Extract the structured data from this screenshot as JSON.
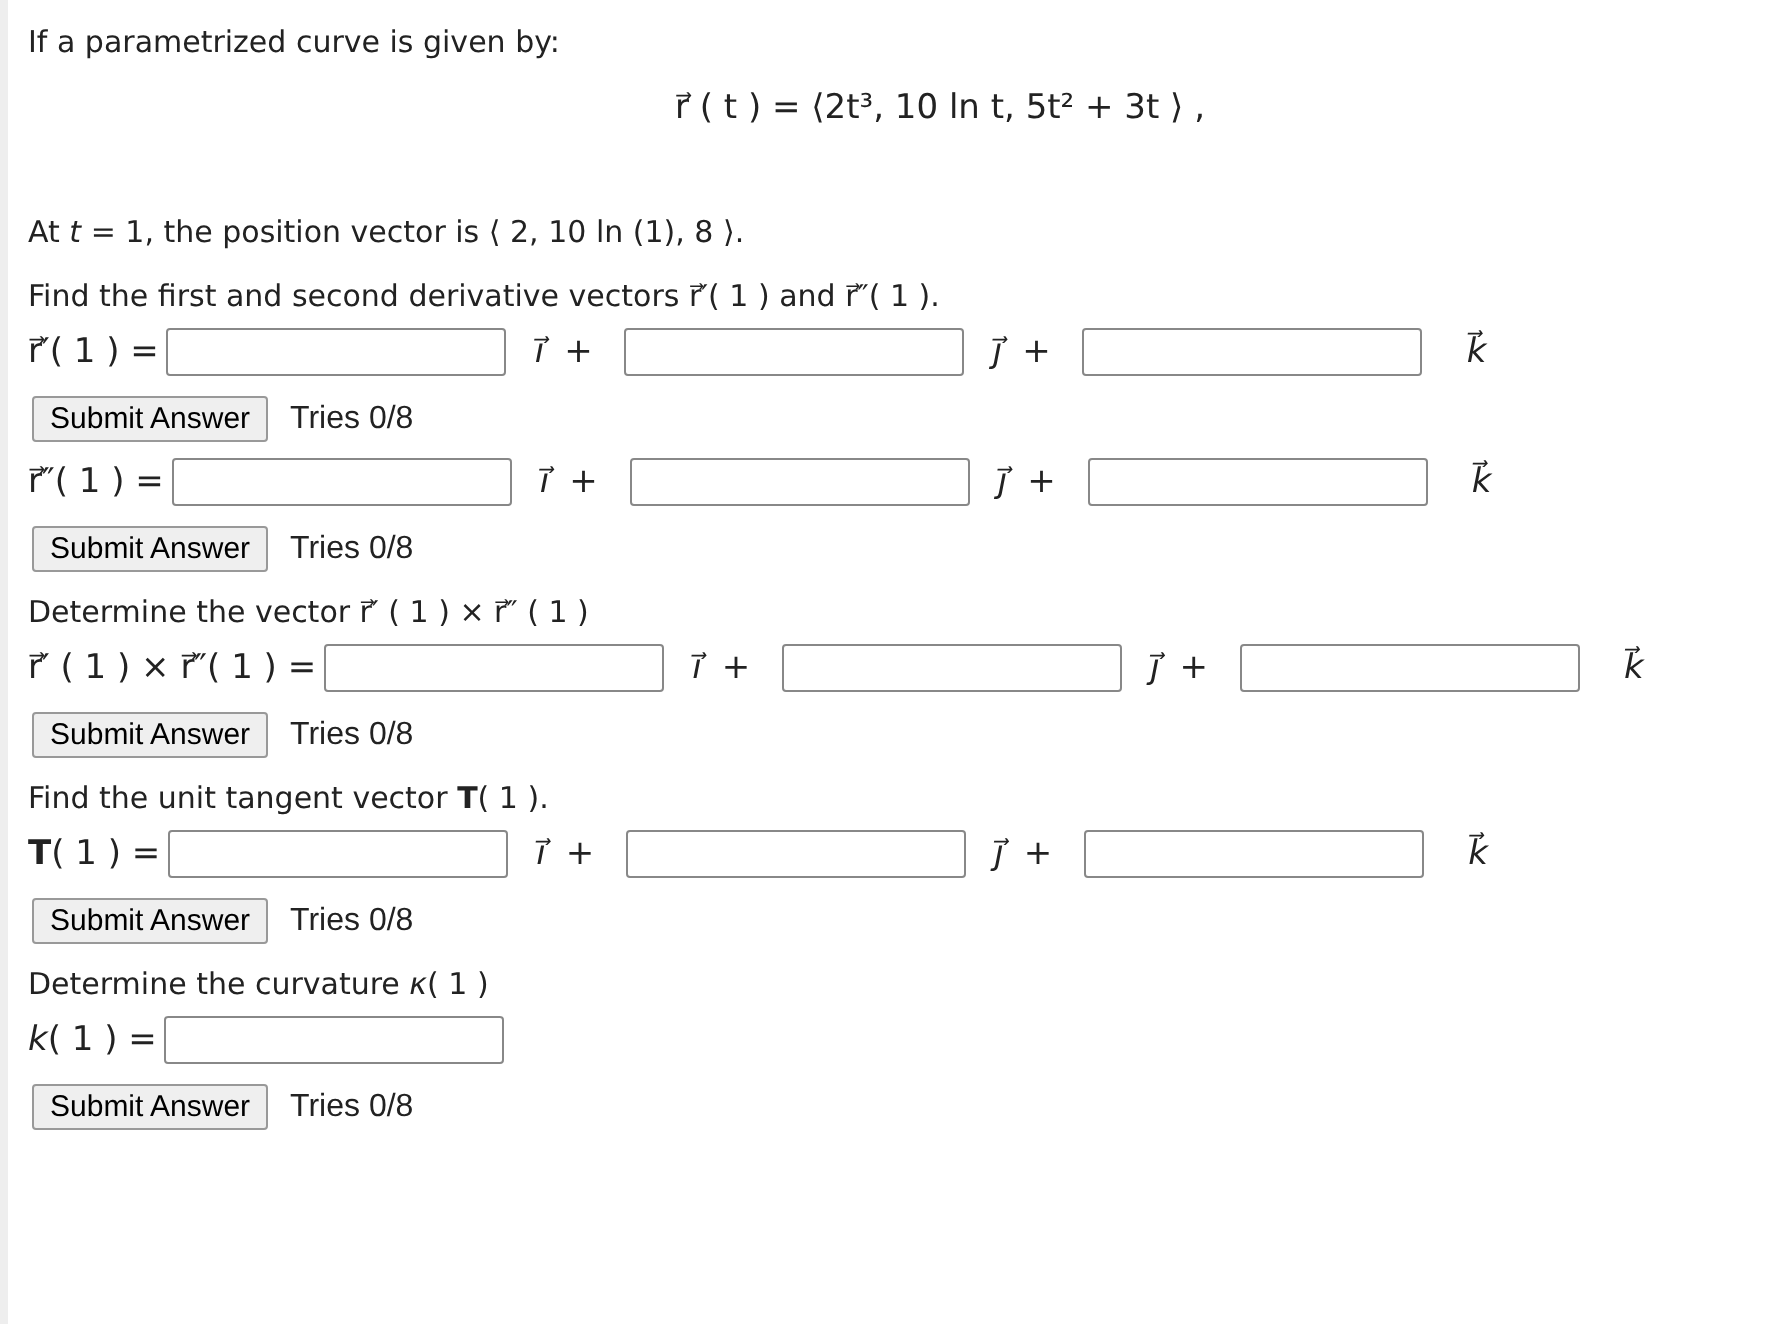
{
  "intro": "If a parametrized curve is given by:",
  "formula": "r⃗ ( t ) = ⟨2t³,  10 ln t,  5t² + 3t ⟩ ,",
  "items": [
    {
      "kind": "prompt",
      "text": "At *t* = 1, the position vector is ⟨ 2,  10 ln (1),  8 ⟩."
    },
    {
      "kind": "prompt",
      "text": "Find the first and second derivative vectors r⃗′( 1 ) and r⃗″( 1 )."
    },
    {
      "kind": "answer",
      "label": "r⃗′( 1 ) =",
      "terms": [
        {
          "basis": "i⃗",
          "op": "+"
        },
        {
          "basis": "j⃗",
          "op": "+"
        },
        {
          "basis": "k⃗"
        }
      ]
    },
    {
      "kind": "submit",
      "button": "Submit Answer",
      "tries": "Tries 0/8"
    },
    {
      "kind": "answer",
      "label": "r⃗″( 1 ) =",
      "terms": [
        {
          "basis": "i⃗",
          "op": "+"
        },
        {
          "basis": "j⃗",
          "op": "+"
        },
        {
          "basis": "k⃗"
        }
      ]
    },
    {
      "kind": "submit",
      "button": "Submit Answer",
      "tries": "Tries 0/8"
    },
    {
      "kind": "prompt",
      "text": "Determine the vector r⃗′ ( 1 ) × r⃗″ ( 1 )"
    },
    {
      "kind": "answer",
      "label": "r⃗′ ( 1 ) × r⃗″( 1 ) =",
      "terms": [
        {
          "basis": "i⃗",
          "op": "+"
        },
        {
          "basis": "j⃗",
          "op": "+"
        },
        {
          "basis": "k⃗"
        }
      ]
    },
    {
      "kind": "submit",
      "button": "Submit Answer",
      "tries": "Tries 0/8"
    },
    {
      "kind": "prompt",
      "text": "Find the unit tangent vector **T**( 1 )."
    },
    {
      "kind": "answer",
      "label": "**T**( 1 ) =",
      "terms": [
        {
          "basis": "i⃗",
          "op": "+"
        },
        {
          "basis": "j⃗",
          "op": "+"
        },
        {
          "basis": "k⃗"
        }
      ]
    },
    {
      "kind": "submit",
      "button": "Submit Answer",
      "tries": "Tries 0/8"
    },
    {
      "kind": "prompt",
      "text": "Determine the curvature *κ*( 1 )"
    },
    {
      "kind": "answer",
      "label": "*k*( 1 ) ="
    },
    {
      "kind": "submit",
      "button": "Submit Answer",
      "tries": "Tries 0/8"
    }
  ]
}
